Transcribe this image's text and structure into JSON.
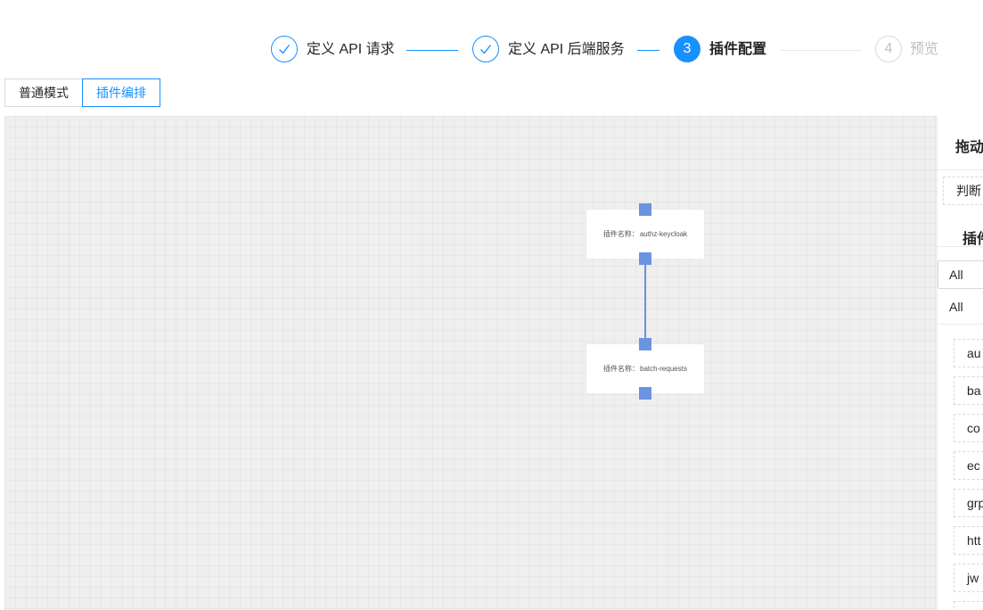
{
  "steps": [
    {
      "status": "done",
      "title": "定义 API 请求",
      "icon": "check-icon"
    },
    {
      "status": "done",
      "title": "定义 API 后端服务",
      "icon": "check-icon"
    },
    {
      "status": "active",
      "number": "3",
      "title": "插件配置"
    },
    {
      "status": "wait",
      "number": "4",
      "title": "预览"
    }
  ],
  "mode_toggle": {
    "normal_label": "普通模式",
    "plugin_label": "插件编排",
    "selected": "插件编排"
  },
  "canvas": {
    "nodes": [
      {
        "prefix": "插件名称：",
        "name": "authz-keycloak"
      },
      {
        "prefix": "插件名称：",
        "name": "batch-requests"
      }
    ],
    "edges": [
      {
        "from": "authz-keycloak",
        "to": "batch-requests"
      }
    ]
  },
  "panel": {
    "drag_title": "拖动",
    "condition_item": "判断",
    "plugin_title": "插件",
    "category_select_value": "All",
    "category_option": "All",
    "plugin_items": [
      "au",
      "ba",
      "co",
      "ec",
      "grp",
      "htt",
      "jw"
    ]
  },
  "colors": {
    "primary": "#1890ff",
    "edge": "#6b93e0",
    "canvas_bg": "#efefef"
  }
}
